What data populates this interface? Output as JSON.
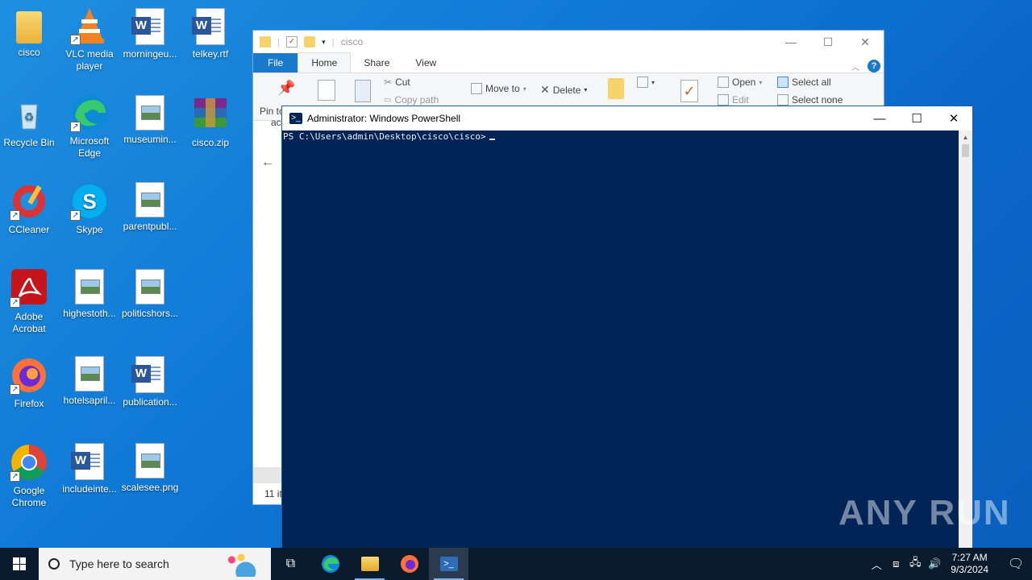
{
  "desktop": {
    "icons": [
      {
        "label": "cisco",
        "icon": "folder-icon"
      },
      {
        "label": "VLC media player",
        "icon": "vlc-icon"
      },
      {
        "label": "morningeu...",
        "icon": "word-doc-icon"
      },
      {
        "label": "telkey.rtf",
        "icon": "word-doc-icon"
      },
      {
        "label": "Recycle Bin",
        "icon": "recycle-bin-icon"
      },
      {
        "label": "Microsoft Edge",
        "icon": "edge-icon"
      },
      {
        "label": "museumin...",
        "icon": "image-file-icon"
      },
      {
        "label": "cisco.zip",
        "icon": "winrar-icon"
      },
      {
        "label": "CCleaner",
        "icon": "ccleaner-icon"
      },
      {
        "label": "Skype",
        "icon": "skype-icon"
      },
      {
        "label": "parentpubl...",
        "icon": "image-file-icon"
      },
      {
        "label": "Adobe Acrobat",
        "icon": "acrobat-icon"
      },
      {
        "label": "highestoth...",
        "icon": "image-file-icon"
      },
      {
        "label": "politicshors...",
        "icon": "image-file-icon"
      },
      {
        "label": "Firefox",
        "icon": "firefox-icon"
      },
      {
        "label": "hotelsapril...",
        "icon": "image-file-icon"
      },
      {
        "label": "publication...",
        "icon": "word-doc-icon"
      },
      {
        "label": "Google Chrome",
        "icon": "chrome-icon"
      },
      {
        "label": "includeinte...",
        "icon": "word-doc-icon"
      },
      {
        "label": "scalesee.png",
        "icon": "image-file-icon"
      }
    ]
  },
  "explorer": {
    "title": "cisco",
    "tabs": {
      "file": "File",
      "home": "Home",
      "share": "Share",
      "view": "View"
    },
    "ribbon": {
      "pin": "Pin to",
      "pin2": "ac",
      "cut": "Cut",
      "copy_path": "Copy path",
      "move_to": "Move to",
      "delete": "Delete",
      "open": "Open",
      "edit": "Edit",
      "select_all": "Select all",
      "select_none": "Select none"
    },
    "status": "11 it"
  },
  "powershell": {
    "title": "Administrator: Windows PowerShell",
    "prompt": "PS C:\\Users\\admin\\Desktop\\cisco\\cisco>"
  },
  "watermark": "ANY RUN",
  "taskbar": {
    "search_placeholder": "Type here to search",
    "time": "7:27 AM",
    "date": "9/3/2024"
  },
  "colors": {
    "console_bg": "#012456",
    "taskbar_bg": "#0b1b2e",
    "file_tab": "#1979ca"
  }
}
